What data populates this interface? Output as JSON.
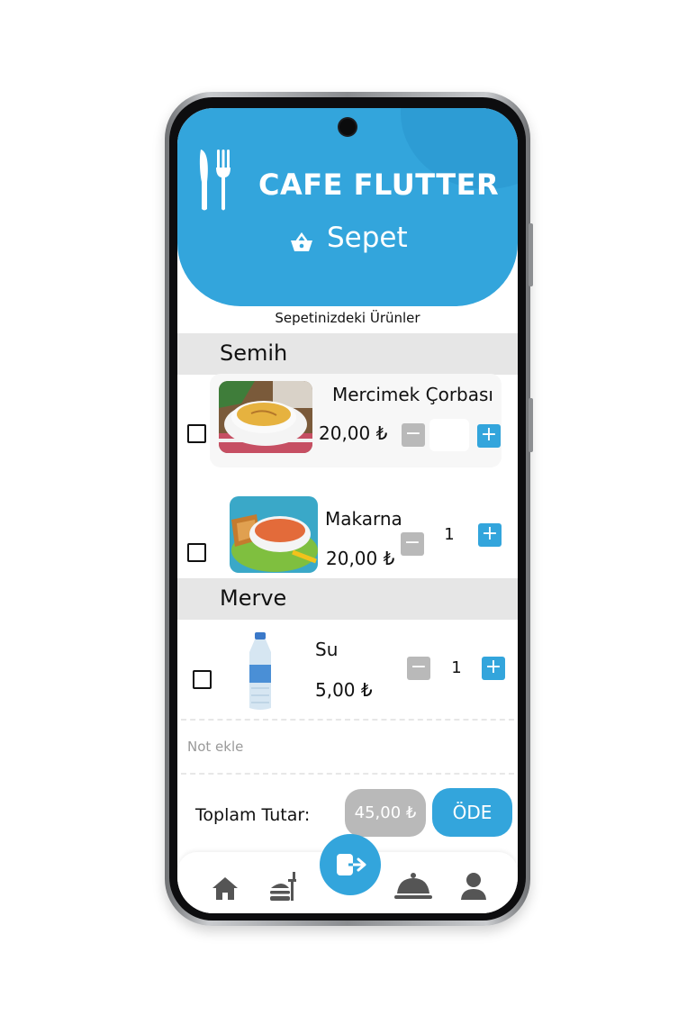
{
  "app": {
    "title": "CAFE FLUTTER",
    "page": "Sepet",
    "section_title": "Sepetinizdeki Ürünler"
  },
  "groups": [
    {
      "name": "Semih",
      "items": [
        {
          "name": "Mercimek Çorbası",
          "price": "20,00 ₺",
          "qty": ""
        },
        {
          "name": "Makarna",
          "price": "20,00 ₺",
          "qty": "1"
        }
      ]
    },
    {
      "name": "Merve",
      "items": [
        {
          "name": "Su",
          "price": "5,00 ₺",
          "qty": "1"
        }
      ]
    }
  ],
  "note": {
    "placeholder": "Not ekle"
  },
  "footer": {
    "total_label": "Toplam Tutar:",
    "total_value": "45,00 ₺",
    "pay_label": "ÖDE"
  },
  "nav": {
    "icons": [
      "home-icon",
      "food-menu-icon",
      "exit-icon",
      "serving-dish-icon",
      "profile-icon"
    ]
  },
  "colors": {
    "accent": "#33a5dc",
    "disabled": "#b9b9b9",
    "group_bar": "#e6e6e6"
  }
}
